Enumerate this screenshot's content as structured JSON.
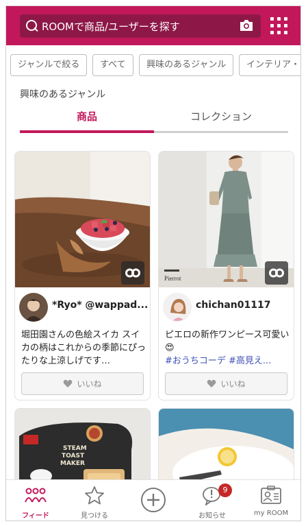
{
  "header": {
    "search_placeholder": "ROOMで商品/ユーザーを探す",
    "brand_color": "#c2185b"
  },
  "filters": {
    "chips": [
      "ジャンルで絞る",
      "すべて",
      "興味のあるジャンル",
      "インテリア・"
    ]
  },
  "section_title": "興味のあるジャンル",
  "tabs": [
    {
      "label": "商品",
      "active": true
    },
    {
      "label": "コレクション",
      "active": false
    }
  ],
  "cards": [
    {
      "username": "*Ryo* @wappad...",
      "description": "堀田園さんの色絵スイカ スイカの柄はこれからの季節にぴったりな上涼しげです…",
      "like_label": "いいね",
      "photo_text": ""
    },
    {
      "username": "chichan01117",
      "description": "ピエロの新作ワンピース可愛い😍",
      "tags": "#おうちコーデ #高見え...",
      "like_label": "いいね",
      "photo_text": "Pierrot"
    }
  ],
  "lower_cards": [
    {
      "package_label": "STEAM TOAST MAKER"
    },
    {
      "package_label": ""
    }
  ],
  "bottom_nav": [
    {
      "label": "フィード",
      "icon": "feed-icon",
      "active": true
    },
    {
      "label": "見つける",
      "icon": "star-icon",
      "active": false
    },
    {
      "label": "",
      "icon": "plus-icon",
      "active": false
    },
    {
      "label": "お知らせ",
      "icon": "notification-icon",
      "active": false,
      "badge": "9"
    },
    {
      "label": "my ROOM",
      "icon": "profile-icon",
      "active": false
    }
  ]
}
